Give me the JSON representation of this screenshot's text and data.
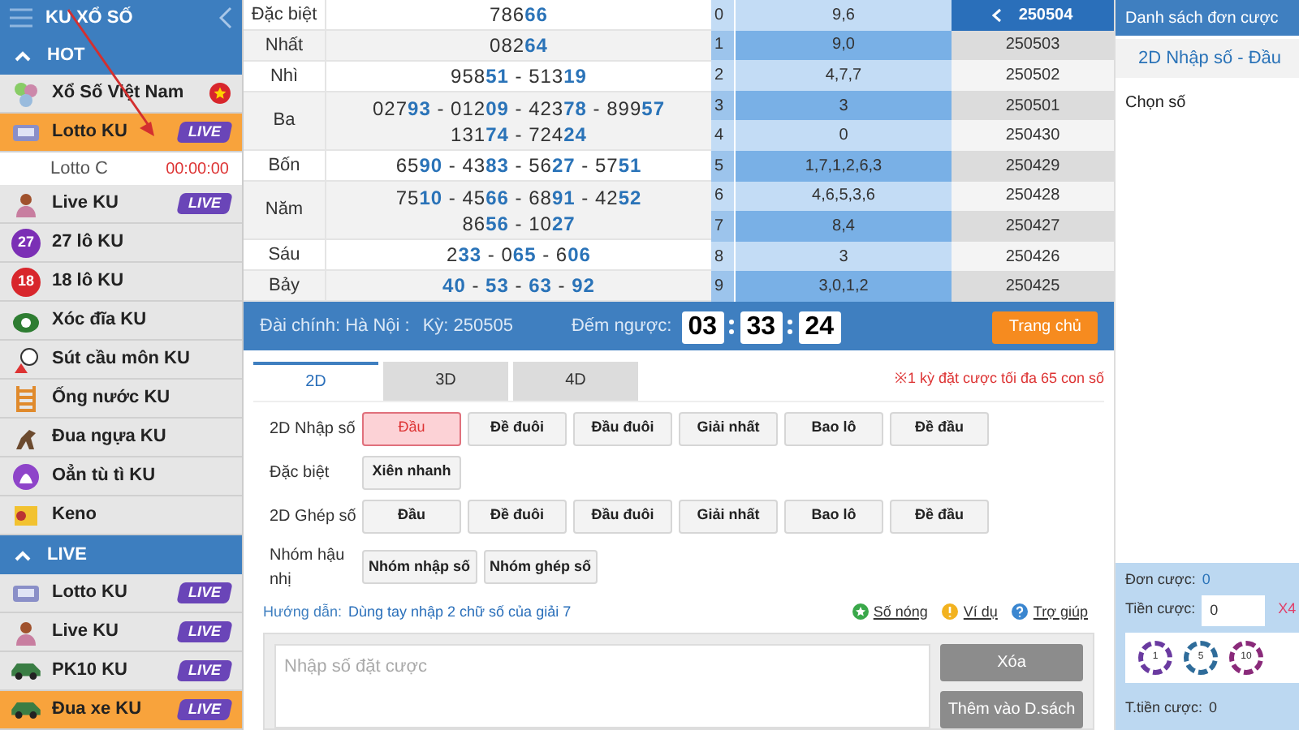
{
  "sidebar": {
    "title": "KU XỔ SỐ",
    "sections": [
      {
        "label": "HOT",
        "expanded": true,
        "items": [
          {
            "label": "Xổ Số Việt Nam",
            "selected": false,
            "kind": "flag"
          },
          {
            "label": "Lotto KU",
            "selected": true,
            "kind": "live",
            "badge": "LIVE"
          },
          {
            "label": "Lotto C",
            "kind": "sub",
            "time": "00:00:00",
            "selected": false
          },
          {
            "label": "Live KU",
            "selected": false,
            "kind": "live",
            "badge": "LIVE"
          },
          {
            "label": "27 lô KU",
            "ball": "27",
            "color": "#7b2fb5",
            "selected": false,
            "kind": "plain"
          },
          {
            "label": "18 lô KU",
            "ball": "18",
            "color": "#d8262c",
            "selected": false,
            "kind": "plain"
          },
          {
            "label": "Xóc đĩa KU",
            "selected": false,
            "kind": "plain"
          },
          {
            "label": "Sút cầu môn KU",
            "selected": false,
            "kind": "plain"
          },
          {
            "label": "Ống nước KU",
            "selected": false,
            "kind": "plain"
          },
          {
            "label": "Đua ngựa KU",
            "selected": false,
            "kind": "plain"
          },
          {
            "label": "Oẳn tù tì KU",
            "selected": false,
            "kind": "plain"
          },
          {
            "label": "Keno",
            "selected": false,
            "kind": "plain"
          }
        ]
      },
      {
        "label": "LIVE",
        "expanded": true,
        "items": [
          {
            "label": "Lotto KU",
            "selected": false,
            "kind": "live",
            "badge": "LIVE"
          },
          {
            "label": "Live KU",
            "selected": false,
            "kind": "live",
            "badge": "LIVE"
          },
          {
            "label": "PK10 KU",
            "selected": false,
            "kind": "live",
            "badge": "LIVE"
          },
          {
            "label": "Đua xe KU",
            "selected": true,
            "kind": "live",
            "badge": "LIVE"
          }
        ]
      }
    ]
  },
  "results": [
    {
      "prize": "Đặc biệt",
      "lines": [
        "786**66**"
      ]
    },
    {
      "prize": "Nhất",
      "lines": [
        "082**64**"
      ]
    },
    {
      "prize": "Nhì",
      "lines": [
        "958**51** - 513**19**"
      ]
    },
    {
      "prize": "Ba",
      "lines": [
        "027**93** - 012**09** - 423**78** - 899**57**",
        "131**74** - 724**24**"
      ]
    },
    {
      "prize": "Bốn",
      "lines": [
        "65**90** - 43**83** - 56**27** - 57**51**"
      ]
    },
    {
      "prize": "Năm",
      "lines": [
        "75**10** - 45**66** - 68**91** - 42**52**",
        "86**56** - 10**27**"
      ]
    },
    {
      "prize": "Sáu",
      "lines": [
        "2**33** - 0**65** - 6**06**"
      ]
    },
    {
      "prize": "Bảy",
      "lines": [
        "**40** - **53** - **63** - **92**"
      ]
    }
  ],
  "digits": [
    {
      "digit": "0",
      "values": "9,6"
    },
    {
      "digit": "1",
      "values": "9,0"
    },
    {
      "digit": "2",
      "values": "4,7,7"
    },
    {
      "digit": "3",
      "values": "3"
    },
    {
      "digit": "4",
      "values": "0"
    },
    {
      "digit": "5",
      "values": "1,7,1,2,6,3"
    },
    {
      "digit": "6",
      "values": "4,6,5,3,6"
    },
    {
      "digit": "7",
      "values": "8,4"
    },
    {
      "digit": "8",
      "values": "3"
    },
    {
      "digit": "9",
      "values": "3,0,1,2"
    }
  ],
  "periods": [
    {
      "label": "250504",
      "selected": true
    },
    {
      "label": "250503",
      "selected": false
    },
    {
      "label": "250502",
      "selected": false
    },
    {
      "label": "250501",
      "selected": false
    },
    {
      "label": "250430",
      "selected": false
    },
    {
      "label": "250429",
      "selected": false
    },
    {
      "label": "250428",
      "selected": false
    },
    {
      "label": "250427",
      "selected": false
    },
    {
      "label": "250426",
      "selected": false
    },
    {
      "label": "250425",
      "selected": false
    }
  ],
  "info_bar": {
    "station": "Đài chính: Hà Nội :",
    "period": "Kỳ: 250505",
    "countdown_label": "Đếm ngược:",
    "countdown": [
      "03",
      "33",
      "24"
    ],
    "home_button": "Trang chủ"
  },
  "tabs": [
    {
      "label": "2D",
      "selected": true
    },
    {
      "label": "3D",
      "selected": false
    },
    {
      "label": "4D",
      "selected": false
    }
  ],
  "notice": "※1 kỳ đặt cược tối đa 65 con số",
  "bet_rows": [
    {
      "label": "2D Nhập số",
      "options": [
        {
          "label": "Đầu",
          "selected": true
        },
        {
          "label": "Đề đuôi",
          "selected": false
        },
        {
          "label": "Đầu đuôi",
          "selected": false
        },
        {
          "label": "Giải nhất",
          "selected": false
        },
        {
          "label": "Bao lô",
          "selected": false
        },
        {
          "label": "Đề đầu",
          "selected": false
        }
      ]
    },
    {
      "label": "Đặc biệt",
      "options": [
        {
          "label": "Xiên nhanh",
          "selected": false
        }
      ]
    },
    {
      "label": "2D Ghép số",
      "options": [
        {
          "label": "Đầu",
          "selected": false
        },
        {
          "label": "Đề đuôi",
          "selected": false
        },
        {
          "label": "Đầu đuôi",
          "selected": false
        },
        {
          "label": "Giải nhất",
          "selected": false
        },
        {
          "label": "Bao lô",
          "selected": false
        },
        {
          "label": "Đề đầu",
          "selected": false
        }
      ]
    },
    {
      "label": "Nhóm hậu nhị",
      "options": [
        {
          "label": "Nhóm nhập số",
          "selected": false
        },
        {
          "label": "Nhóm ghép số",
          "selected": false
        }
      ]
    }
  ],
  "guide": {
    "label": "Hướng dẫn:",
    "text": "Dùng tay nhập 2 chữ số của giải 7"
  },
  "help_links": [
    {
      "label": "Số nóng",
      "kind": "star"
    },
    {
      "label": "Ví dụ",
      "kind": "info"
    },
    {
      "label": "Trợ giúp",
      "kind": "help"
    }
  ],
  "entry": {
    "placeholder": "Nhập số đặt cược",
    "buttons": [
      "Xóa",
      "Thêm vào D.sách"
    ]
  },
  "bet_list": {
    "title": "Danh sách đơn cược",
    "mode": "2D Nhập số - Đầu",
    "prompt": "Chọn số",
    "orders_label": "Đơn cược:",
    "orders": "0",
    "amount_label": "Tiền cược:",
    "amount": "0",
    "multiplier": "X4",
    "chips": [
      {
        "label": "1",
        "color": "#6a3aa0"
      },
      {
        "label": "5",
        "color": "#2f6c9a"
      },
      {
        "label": "10",
        "color": "#8a2a7a"
      }
    ],
    "total_label": "T.tiền cược:",
    "total": "0"
  }
}
